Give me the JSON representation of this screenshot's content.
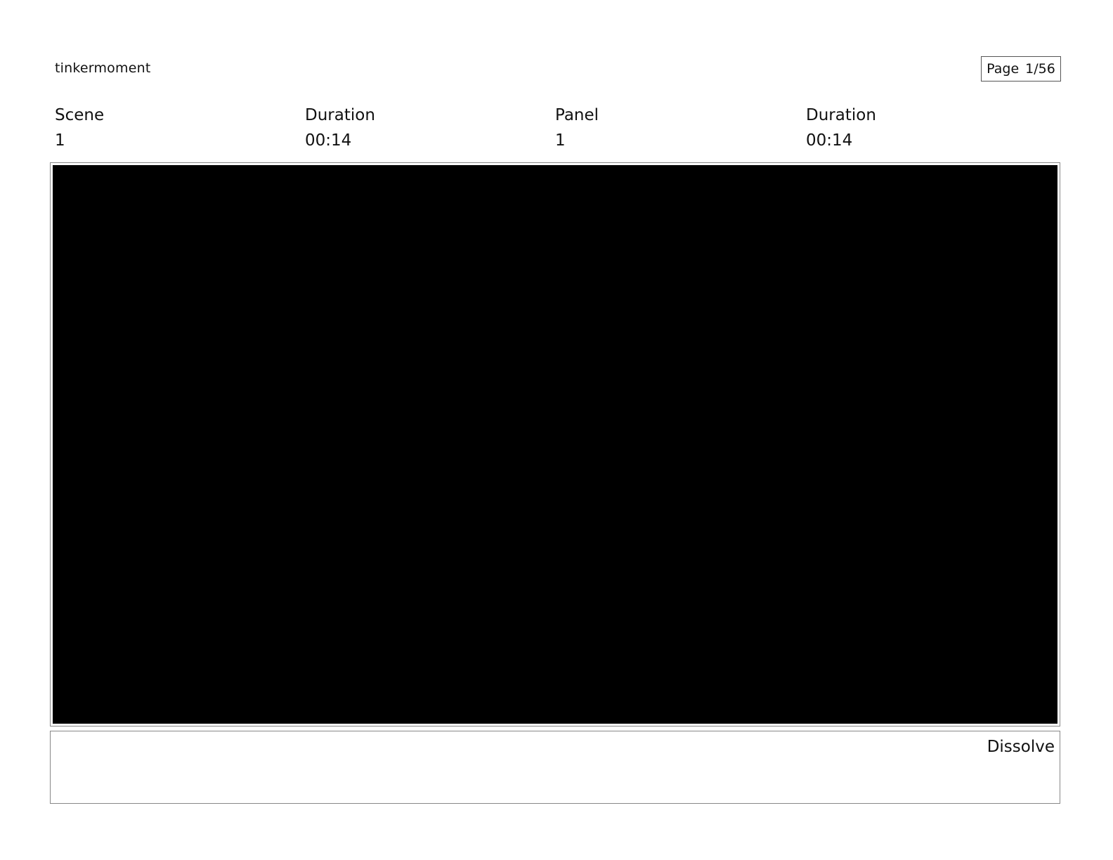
{
  "header": {
    "project_name": "tinkermoment",
    "page_label": "Page",
    "page_number": "1/56"
  },
  "meta": {
    "scene_label": "Scene",
    "scene_value": "1",
    "scene_duration_label": "Duration",
    "scene_duration_value": "00:14",
    "panel_label": "Panel",
    "panel_value": "1",
    "panel_duration_label": "Duration",
    "panel_duration_value": "00:14"
  },
  "notes": {
    "transition": "Dissolve"
  },
  "colors": {
    "panel_fill": "#000000",
    "border": "#888888"
  }
}
